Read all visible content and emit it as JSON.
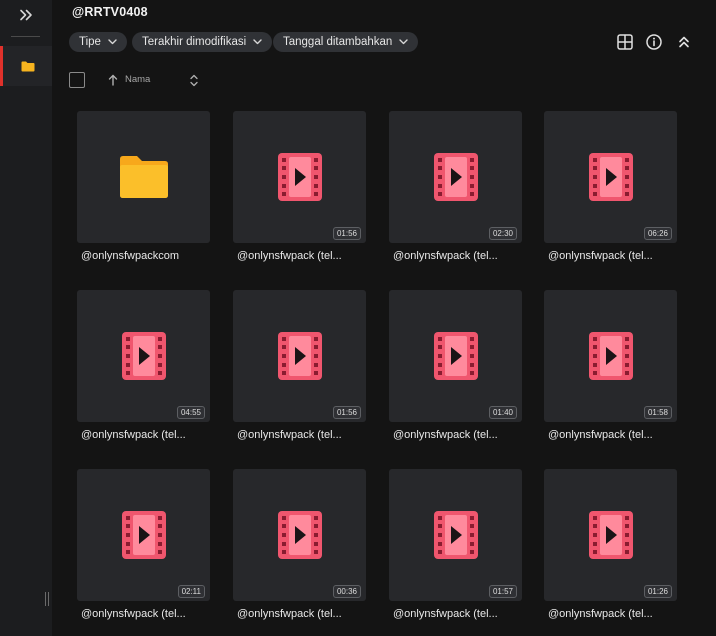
{
  "app": {
    "folder_title": "@RRTV0408"
  },
  "filters": [
    {
      "label": "Tipe"
    },
    {
      "label": "Terakhir dimodifikasi"
    },
    {
      "label": "Tanggal ditambahkan"
    }
  ],
  "sort": {
    "label": "Nama",
    "direction": "ascending"
  },
  "icons": {
    "sidebar_toggle": "double-chevron-right-icon",
    "sidebar_folder": "folder-icon",
    "grid_view": "grid-icon",
    "info": "info-icon",
    "collapse": "double-chevron-up-icon",
    "video_file": "film-play-icon"
  },
  "colors": {
    "accent": "#e0312b",
    "video_icon": "#f0566e",
    "folder_icon": "#f7b41f"
  },
  "items": [
    {
      "type": "folder",
      "name": "@onlynsfwpackcom",
      "duration": ""
    },
    {
      "type": "video",
      "name": "@onlynsfwpack (tel...",
      "duration": "01:56"
    },
    {
      "type": "video",
      "name": "@onlynsfwpack (tel...",
      "duration": "02:30"
    },
    {
      "type": "video",
      "name": "@onlynsfwpack (tel...",
      "duration": "06:26"
    },
    {
      "type": "video",
      "name": "@onlynsfwpack (tel...",
      "duration": "04:55"
    },
    {
      "type": "video",
      "name": "@onlynsfwpack (tel...",
      "duration": "01:56"
    },
    {
      "type": "video",
      "name": "@onlynsfwpack (tel...",
      "duration": "01:40"
    },
    {
      "type": "video",
      "name": "@onlynsfwpack (tel...",
      "duration": "01:58"
    },
    {
      "type": "video",
      "name": "@onlynsfwpack (tel...",
      "duration": "02:11"
    },
    {
      "type": "video",
      "name": "@onlynsfwpack (tel...",
      "duration": "00:36"
    },
    {
      "type": "video",
      "name": "@onlynsfwpack (tel...",
      "duration": "01:57"
    },
    {
      "type": "video",
      "name": "@onlynsfwpack (tel...",
      "duration": "01:26"
    }
  ]
}
